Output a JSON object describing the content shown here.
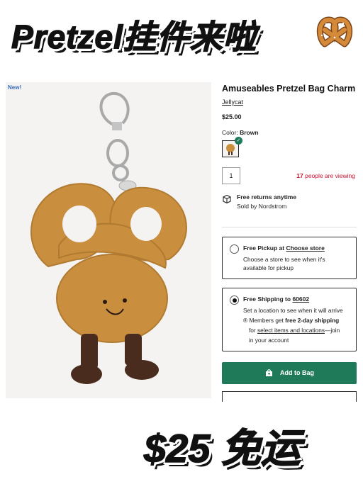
{
  "headline": {
    "text": "Pretzel挂件来啦"
  },
  "product": {
    "badge": "New!",
    "title": "Amuseables Pretzel Bag Charm",
    "brand": "Jellycat",
    "price": "$25.00",
    "color_label": "Color:",
    "color_value": "Brown",
    "quantity": "1",
    "viewers_count": "17",
    "viewers_text": "people are viewing"
  },
  "returns": {
    "title": "Free returns anytime",
    "sub": "Sold by Nordstrom"
  },
  "pickup": {
    "label": "Free Pickup at",
    "link": "Choose store",
    "line1": "Choose a store to see when it's",
    "line2": "available for pickup",
    "selected": false
  },
  "shipping": {
    "label": "Free Shipping to",
    "zip": "60602",
    "line1": "Set a location to see when it will arrive",
    "line2_prefix": "Members get",
    "line2_bold": "free 2-day shipping",
    "line3_prefix": "for",
    "line3_link": "select items and locations",
    "line3_suffix": "—join",
    "line4": "in your account",
    "selected": true
  },
  "add_to_bag": {
    "label": "Add to Bag"
  },
  "bottom_banner": {
    "text": "$25 免运"
  },
  "colors": {
    "accent_green": "#1f7a5a",
    "alert_red": "#c8102e",
    "pretzel": "#c98f3e",
    "feet": "#4a2c1e"
  },
  "icons": [
    "pretzel-emoji-icon",
    "check-icon",
    "returns-box-icon",
    "radio-icon",
    "bag-icon"
  ]
}
